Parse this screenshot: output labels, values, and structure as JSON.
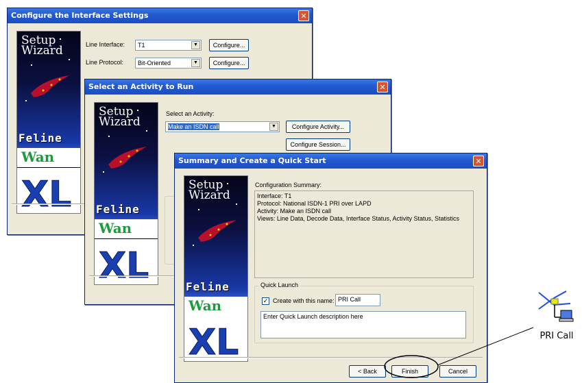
{
  "window1": {
    "title": "Configure the Interface Settings",
    "line_interface_label": "Line Interface:",
    "line_interface_value": "T1",
    "line_protocol_label": "Line Protocol:",
    "line_protocol_value": "Bit-Oriented",
    "configure_label": "Configure..."
  },
  "window2": {
    "title": "Select an Activity to Run",
    "select_activity_label": "Select an Activity:",
    "activity_value": "Make an ISDN call",
    "configure_activity_label": "Configure Activity...",
    "configure_session_label": "Configure Session..."
  },
  "window3": {
    "title": "Summary and Create a Quick Start",
    "config_summary_label": "Configuration Summary:",
    "summary_lines": [
      "Interface: T1",
      "Protocol: National ISDN-1 PRI over LAPD",
      "Activity: Make an ISDN call",
      "Views: Line Data, Decode Data, Interface Status, Activity Status, Statistics"
    ],
    "quick_launch_label": "Quick Launch",
    "create_with_name_label": "Create with this name:",
    "create_checked": true,
    "name_value": "PRI Call",
    "description_value": "Enter Quick Launch description here",
    "back_label": "< Back",
    "finish_label": "Finish",
    "cancel_label": "Cancel"
  },
  "wizard_graphic": {
    "setup_text": "Setup",
    "wizard_text": "Wizard",
    "feline_text": "Feline",
    "wan_text": "Wan",
    "xl_text": "XL"
  },
  "desktop_icon": {
    "label": "PRI Call",
    "icon": "network-call-icon"
  },
  "colors": {
    "titlebar": "#2159d0",
    "dialog_bg": "#ece9d8",
    "close_button": "#d9532f",
    "selection": "#316ac5"
  }
}
